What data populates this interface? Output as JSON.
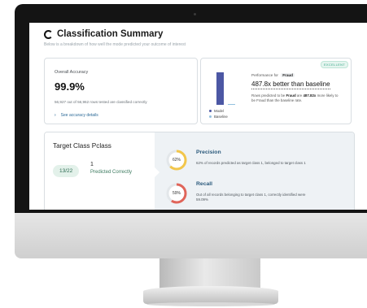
{
  "app": {
    "title": "Classification Summary",
    "subtitle": "Below is a breakdown of how well the mode predicted your outcome of interest"
  },
  "accuracy": {
    "label": "Overall Accuracy",
    "value": "99.9%",
    "note": "56,927 out of 56,962 rows tested are classified correctly",
    "link_label": "See accuracy details"
  },
  "performance": {
    "badge": "EXCELLENT",
    "for_label": "Performance for",
    "class_tag": "Fraud",
    "headline": "487.8x better than baseline",
    "desc_prefix": "Rows predicted to be ",
    "desc_class": "Fraud",
    "desc_mid": " are ",
    "desc_mult": "487.82x",
    "desc_suffix": " more likely to be Fraud than the baseline rate.",
    "legend": [
      {
        "label": "Model",
        "color": "#4c57a4"
      },
      {
        "label": "Baseline",
        "color": "#93c1df"
      }
    ],
    "bars": {
      "model_fraction": 1.0,
      "baseline_fraction": 0.002
    }
  },
  "target": {
    "title": "Target Class Pclass",
    "chip": "13/22",
    "count": "1",
    "count_sub": "Predicted Correctly"
  },
  "metrics": {
    "precision": {
      "name": "Precision",
      "value_label": "62%",
      "fraction": 0.62,
      "color": "#f2c64b",
      "desc": "62% of records predicted as target class 1, belonged to target class 1"
    },
    "recall": {
      "name": "Recall",
      "value_label": "59%",
      "fraction": 0.59,
      "color": "#e0655a",
      "desc": "Out of all records belonging to target class 1, correctly identified were 59.09%"
    }
  }
}
